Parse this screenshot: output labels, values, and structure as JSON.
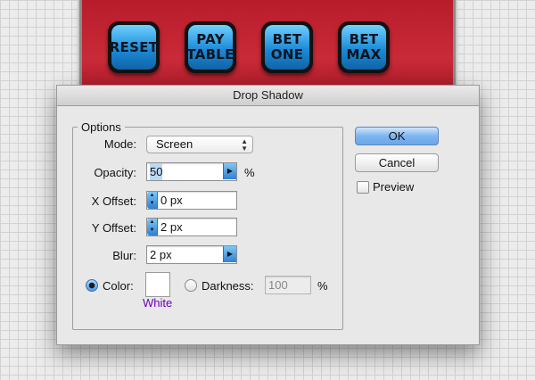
{
  "game_buttons": [
    {
      "line1": "RESET",
      "line2": ""
    },
    {
      "line1": "PAY",
      "line2": "TABLE"
    },
    {
      "line1": "BET",
      "line2": "ONE"
    },
    {
      "line1": "BET",
      "line2": "MAX"
    }
  ],
  "dialog": {
    "title": "Drop Shadow",
    "options_group": "Options",
    "mode": {
      "label": "Mode:",
      "value": "Screen"
    },
    "opacity": {
      "label": "Opacity:",
      "value": "50",
      "unit": "%"
    },
    "x_offset": {
      "label": "X Offset:",
      "value": "0 px"
    },
    "y_offset": {
      "label": "Y Offset:",
      "value": "2 px"
    },
    "blur": {
      "label": "Blur:",
      "value": "2 px"
    },
    "color": {
      "label": "Color:",
      "swatch_name": "White",
      "swatch_hex": "#ffffff",
      "selected": true
    },
    "darkness": {
      "label": "Darkness:",
      "value": "100",
      "unit": "%",
      "selected": false
    },
    "ok_label": "OK",
    "cancel_label": "Cancel",
    "preview_label": "Preview",
    "preview_checked": false
  },
  "colors": {
    "panel_red": "#c92a38",
    "button_blue": "#1d8ad6",
    "swatch_label_purple": "#6e00b8"
  }
}
